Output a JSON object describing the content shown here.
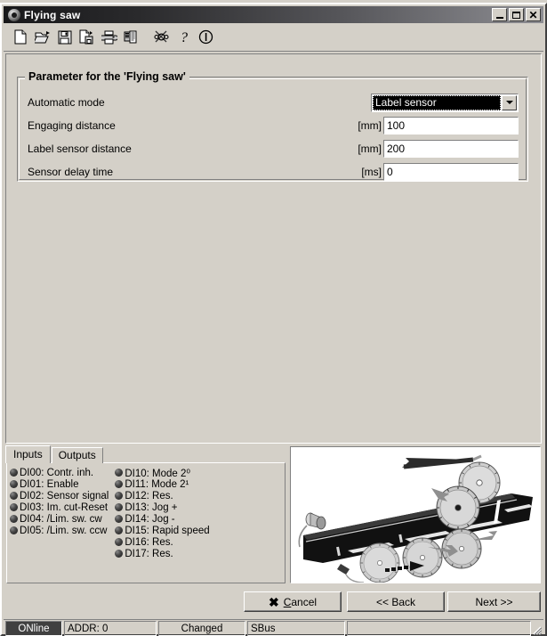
{
  "window": {
    "title": "Flying saw",
    "icon": "app-circle-icon",
    "buttons": {
      "minimize": "minimize-icon",
      "maximize": "maximize-icon",
      "close": "✕"
    }
  },
  "toolbar": {
    "items": [
      {
        "name": "new-file-icon",
        "tooltip": "New"
      },
      {
        "name": "open-folder-icon",
        "tooltip": "Open"
      },
      {
        "name": "save-disk-icon",
        "tooltip": "Save"
      },
      {
        "name": "save-as-icon",
        "tooltip": "Save as"
      },
      {
        "name": "print-icon",
        "tooltip": "Print"
      },
      {
        "name": "print-preview-icon",
        "tooltip": "Print preview"
      },
      {
        "name": "connect-icon",
        "tooltip": "Connection"
      },
      {
        "name": "help-question-icon",
        "tooltip": "Help"
      },
      {
        "name": "info-icon",
        "tooltip": "Info"
      }
    ]
  },
  "group": {
    "title": "Parameter for the 'Flying saw'"
  },
  "parameters": [
    {
      "label": "Automatic mode",
      "unit": "",
      "type": "combo",
      "value": "Label sensor",
      "name": "automatic-mode"
    },
    {
      "label": "Engaging distance",
      "unit": "[mm]",
      "type": "text",
      "value": "100",
      "name": "engaging-distance"
    },
    {
      "label": "Label sensor distance",
      "unit": "[mm]",
      "type": "text",
      "value": "200",
      "name": "label-sensor-distance"
    },
    {
      "label": "Sensor delay time",
      "unit": "[ms]",
      "type": "text",
      "value": "0",
      "name": "sensor-delay-time"
    }
  ],
  "io": {
    "tabs": [
      {
        "label": "Inputs",
        "active": true
      },
      {
        "label": "Outputs",
        "active": false
      }
    ],
    "column_left": [
      "DI00: Contr. inh.",
      "DI01: Enable",
      "DI02: Sensor signal",
      "DI03: Im. cut-Reset",
      "DI04: /Lim. sw. cw",
      "DI05: /Lim. sw. ccw"
    ],
    "column_right": [
      "DI10: Mode 2⁰",
      "DI11: Mode 2¹",
      "DI12: Res.",
      "DI13: Jog +",
      "DI14: Jog -",
      "DI15: Rapid speed",
      "DI16: Res.",
      "DI17: Res."
    ]
  },
  "picture": {
    "name": "flying-saw-diagram",
    "description": "Technical illustration of a flying saw: conveyor rail with circular saw blades and a sensor"
  },
  "buttons": {
    "cancel": {
      "label": "Cancel",
      "accel": "C",
      "icon": "✖"
    },
    "back": {
      "label": "<< Back"
    },
    "next": {
      "label": "Next >>"
    }
  },
  "statusbar": {
    "online": "ONline",
    "address": "ADDR: 0",
    "changed": "Changed",
    "bus": "SBus",
    "blank": ""
  }
}
